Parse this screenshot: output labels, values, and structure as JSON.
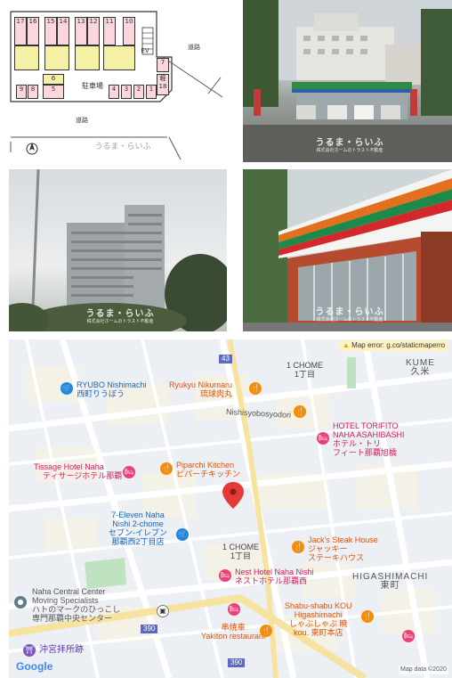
{
  "floorplan": {
    "top_slots": [
      "17",
      "16",
      "15",
      "14",
      "13",
      "12",
      "11",
      "10"
    ],
    "bottom_slots": [
      "9",
      "8",
      "5",
      "4",
      "3",
      "2",
      "1"
    ],
    "mid_slot": "6",
    "right_slots": [
      "7",
      "18"
    ],
    "ev_label": "EV",
    "parking_label": "駐車場",
    "road_right": "道路",
    "road_bottom": "道路",
    "right_light_label": "軽",
    "watermark": "うるま・らいふ"
  },
  "photos": {
    "watermark_main": "うるま・らいふ",
    "watermark_sub": "株式会社ホームのトラスト不動産"
  },
  "map": {
    "error_text": "Map error: g.co/staticmaperro",
    "kume_en": "KUME",
    "kume_ja": "久米",
    "chome1_top_en": "1 CHOME",
    "chome1_top_ja": "1丁目",
    "ryubo_en": "RYUBO Nishimachi",
    "ryubo_ja": "西町りうぼう",
    "ryukyu_en": "Ryukyu Nikumaru",
    "ryukyu_ja": "琉球肉丸",
    "street": "Nishisyobosyodori",
    "torifito_en1": "HOTEL TORIFITO",
    "torifito_en2": "NAHA ASAHIBASHI",
    "torifito_ja1": "ホテル・トリ",
    "torifito_ja2": "フィート那覇旭橋",
    "tissage_en": "Tissage Hotel Naha",
    "tissage_ja": "ティサージホテル那覇",
    "piparchi_en": "Piparchi Kitchen",
    "piparchi_ja": "ピパーチキッチン",
    "seven_en1": "7-Eleven Naha",
    "seven_en2": "Nishi 2-chome",
    "seven_ja1": "セブン-イレブン",
    "seven_ja2": "那覇西2丁目店",
    "chome1_mid_en": "1 CHOME",
    "chome1_mid_ja": "1丁目",
    "jacks_en": "Jack's Steak House",
    "jacks_ja": "ジャッキー",
    "jacks_ja2": "ステーキハウス",
    "nest_en": "Nest Hotel Naha Nishi",
    "nest_ja": "ネストホテル那覇西",
    "higashi_en": "HIGASHIMACHI",
    "higashi_ja": "東町",
    "naha_center_en1": "Naha Central Center",
    "naha_center_en2": "Moving Specialists",
    "naha_center_ja1": "ハトのマークのひっこし",
    "naha_center_ja2": "専門那覇中央センター",
    "shabu_en1": "Shabu-shabu KOU",
    "shabu_en2": "Higashimachi",
    "shabu_ja1": "しゃぶしゃぶ 暁",
    "shabu_ja2": "kou. 東町本店",
    "kushiyaki_ja": "串焼車",
    "kushiyaki_en": "Yakiton restaurant",
    "okinomiya_ja": "沖宮拝所跡",
    "road_390a": "390",
    "road_390b": "390",
    "road_43": "43",
    "google": "Google",
    "map_data": "Map data ©2020"
  }
}
